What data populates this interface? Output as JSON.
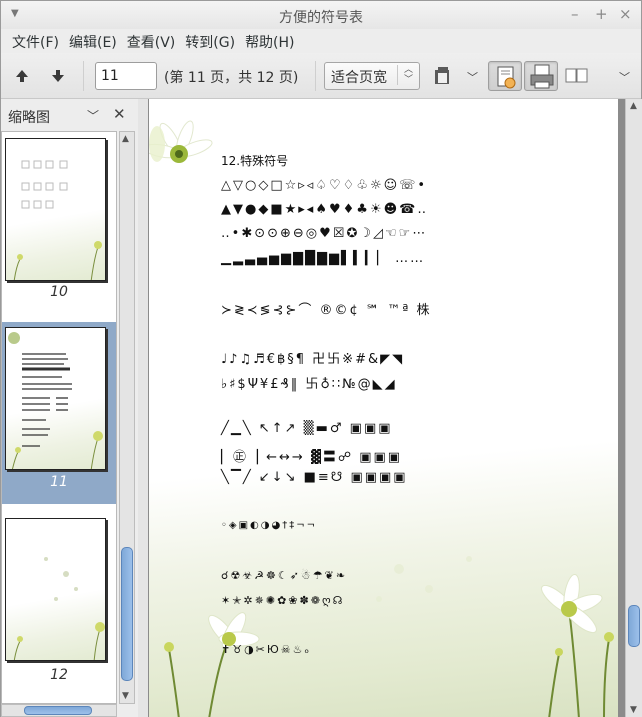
{
  "window": {
    "title": "方便的符号表"
  },
  "menu": [
    "文件(F)",
    "编辑(E)",
    "查看(V)",
    "转到(G)",
    "帮助(H)"
  ],
  "toolbar": {
    "page_value": "11",
    "page_label": "(第 11 页，共 12 页)",
    "zoom_value": "适合页宽"
  },
  "sidebar": {
    "title": "缩略图",
    "thumbnails": [
      {
        "label": "10",
        "selected": false
      },
      {
        "label": "11",
        "selected": true
      },
      {
        "label": "12",
        "selected": false
      }
    ]
  },
  "document": {
    "heading": "12.特殊符号",
    "lines": [
      "△▽○◇□☆▹◃♤♡♢♧☼☺☏•",
      "▲▼●◆■★▸◂♠♥♦♣☀☻☎‥",
      "‥•✱⊙⊙⊕⊖◎♥☒✪☽◿☜☞⋯",
      "▁▂▃▄▅▆▇█▇▆▌▍▎▏ ……",
      "≻≷≺≶⊰⊱⌒ ®©¢ ℠ ™ª 株",
      "♩♪♫♬€฿§¶ 卍卐※#&◤◥",
      "♭♯$Ψ¥£₰‖ 卐♁∷№@◣◢",
      "╱▁╲ ↖↑↗ ▒▬♂ ▣▣▣",
      "▏㊣▕ ←↔→ ▓〓☍ ▣▣▣",
      "╲▔╱ ↙↓↘ ■≡☋ ▣▣▣▣",
      "◦◈▣◐◑◕†‡¬¬",
      "☌☢☣☭☸☾➶☃☂❦❧",
      "✶✭✲✵✺✿❀✽❁ღ☊",
      "✝♉◑✂Ю☠♨ₒ"
    ]
  }
}
